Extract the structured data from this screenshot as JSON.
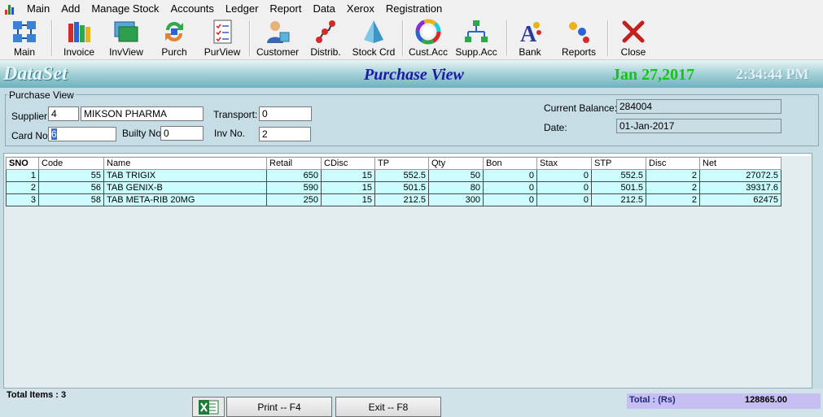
{
  "menu": [
    "Main",
    "Add",
    "Manage Stock",
    "Accounts",
    "Ledger",
    "Report",
    "Data",
    "Xerox",
    "Registration"
  ],
  "toolbar": {
    "main": "Main",
    "invoice": "Invoice",
    "invview": "InvView",
    "purch": "Purch",
    "purview": "PurView",
    "customer": "Customer",
    "distrib": "Distrib.",
    "stockcrd": "Stock Crd",
    "custacc": "Cust.Acc",
    "suppacc": "Supp.Acc",
    "bank": "Bank",
    "reports": "Reports",
    "close": "Close"
  },
  "banner": {
    "brand": "DataSet",
    "title": "Purchase  View",
    "date": "Jan 27,2017",
    "time": "2:34:44 PM"
  },
  "form": {
    "group_label": "Purchase View",
    "supplier_label": "Supplier:",
    "supplier_code": "4",
    "supplier_name": "MIKSON PHARMA",
    "transport_label": "Transport:",
    "transport_value": "0",
    "card_label": "Card No:",
    "card_value": "6",
    "builty_label": "Builty No.",
    "builty_value": "0",
    "inv_label": "Inv No.",
    "inv_value": "2",
    "balance_label": "Current Balance:",
    "balance_value": "284004",
    "date_label": "Date:",
    "date_value": "01-Jan-2017"
  },
  "grid": {
    "columns": [
      "SNO",
      "Code",
      "Name",
      "Retail",
      "CDisc",
      "TP",
      "Qty",
      "Bon",
      "Stax",
      "STP",
      "Disc",
      "Net"
    ],
    "rows": [
      [
        "1",
        "55",
        "TAB TRIGIX",
        "650",
        "15",
        "552.5",
        "50",
        "0",
        "0",
        "552.5",
        "2",
        "27072.5"
      ],
      [
        "2",
        "56",
        "TAB GENIX-B",
        "590",
        "15",
        "501.5",
        "80",
        "0",
        "0",
        "501.5",
        "2",
        "39317.6"
      ],
      [
        "3",
        "58",
        "TAB META-RIB 20MG",
        "250",
        "15",
        "212.5",
        "300",
        "0",
        "0",
        "212.5",
        "2",
        "62475"
      ]
    ]
  },
  "footer": {
    "total_items": "Total Items : 3",
    "print_label": "Print -- F4",
    "exit_label": "Exit -- F8",
    "total_label": "Total :   (Rs)",
    "total_value": "128865.00"
  },
  "colors": {
    "row_bg": "#ccfcfd",
    "title": "#1a1aa6",
    "date": "#16c416",
    "total_bg": "#c7bff4"
  }
}
